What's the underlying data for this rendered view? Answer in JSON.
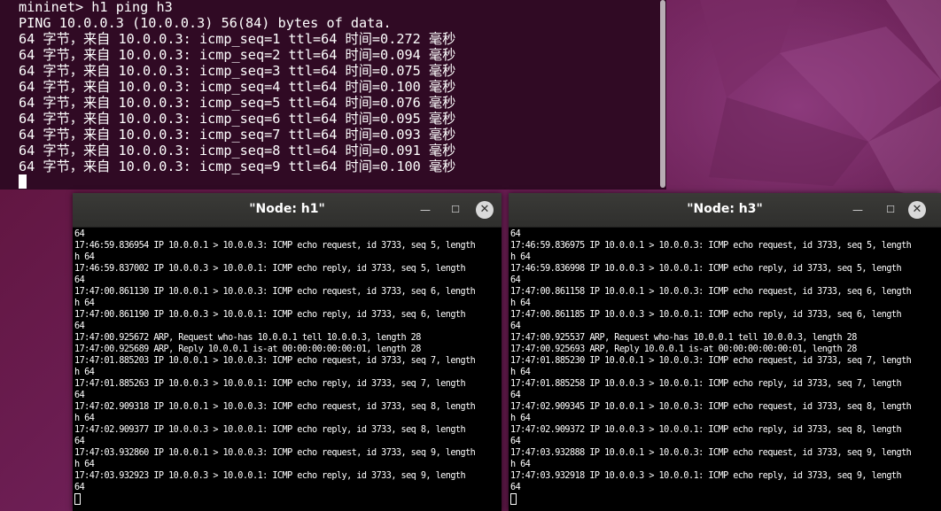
{
  "colors": {
    "terminal_bg": "#300a24",
    "terminal_fg": "#ffffff",
    "xterm_bg": "#000000",
    "titlebar_bg": "#333331",
    "desktop_accent": "#6e1f56"
  },
  "main_terminal": {
    "lines": [
      "mininet> h1 ping h3",
      "PING 10.0.0.3 (10.0.0.3) 56(84) bytes of data.",
      "64 字节，来自 10.0.0.3: icmp_seq=1 ttl=64 时间=0.272 毫秒",
      "64 字节，来自 10.0.0.3: icmp_seq=2 ttl=64 时间=0.094 毫秒",
      "64 字节，来自 10.0.0.3: icmp_seq=3 ttl=64 时间=0.075 毫秒",
      "64 字节，来自 10.0.0.3: icmp_seq=4 ttl=64 时间=0.100 毫秒",
      "64 字节，来自 10.0.0.3: icmp_seq=5 ttl=64 时间=0.076 毫秒",
      "64 字节，来自 10.0.0.3: icmp_seq=6 ttl=64 时间=0.095 毫秒",
      "64 字节，来自 10.0.0.3: icmp_seq=7 ttl=64 时间=0.093 毫秒",
      "64 字节，来自 10.0.0.3: icmp_seq=8 ttl=64 时间=0.091 毫秒",
      "64 字节，来自 10.0.0.3: icmp_seq=9 ttl=64 时间=0.100 毫秒"
    ]
  },
  "windows": {
    "h1": {
      "title": "\"Node: h1\"",
      "minimize_glyph": "—",
      "maximize_glyph": "☐",
      "close_glyph": "✕",
      "lines": [
        "64",
        "17:46:59.836954 IP 10.0.0.1 > 10.0.0.3: ICMP echo request, id 3733, seq 5, length",
        "h 64",
        "17:46:59.837002 IP 10.0.0.3 > 10.0.0.1: ICMP echo reply, id 3733, seq 5, length",
        "64",
        "17:47:00.861130 IP 10.0.0.1 > 10.0.0.3: ICMP echo request, id 3733, seq 6, length",
        "h 64",
        "17:47:00.861190 IP 10.0.0.3 > 10.0.0.1: ICMP echo reply, id 3733, seq 6, length",
        "64",
        "17:47:00.925672 ARP, Request who-has 10.0.0.1 tell 10.0.0.3, length 28",
        "17:47:00.925689 ARP, Reply 10.0.0.1 is-at 00:00:00:00:00:01, length 28",
        "17:47:01.885203 IP 10.0.0.1 > 10.0.0.3: ICMP echo request, id 3733, seq 7, length",
        "h 64",
        "17:47:01.885263 IP 10.0.0.3 > 10.0.0.1: ICMP echo reply, id 3733, seq 7, length",
        "64",
        "17:47:02.909318 IP 10.0.0.1 > 10.0.0.3: ICMP echo request, id 3733, seq 8, length",
        "h 64",
        "17:47:02.909377 IP 10.0.0.3 > 10.0.0.1: ICMP echo reply, id 3733, seq 8, length",
        "64",
        "17:47:03.932860 IP 10.0.0.1 > 10.0.0.3: ICMP echo request, id 3733, seq 9, length",
        "h 64",
        "17:47:03.932923 IP 10.0.0.3 > 10.0.0.1: ICMP echo reply, id 3733, seq 9, length",
        "64"
      ]
    },
    "h3": {
      "title": "\"Node: h3\"",
      "minimize_glyph": "—",
      "maximize_glyph": "☐",
      "close_glyph": "✕",
      "lines": [
        "64",
        "17:46:59.836975 IP 10.0.0.1 > 10.0.0.3: ICMP echo request, id 3733, seq 5, length",
        "h 64",
        "17:46:59.836998 IP 10.0.0.3 > 10.0.0.1: ICMP echo reply, id 3733, seq 5, length",
        "64",
        "17:47:00.861158 IP 10.0.0.1 > 10.0.0.3: ICMP echo request, id 3733, seq 6, length",
        "h 64",
        "17:47:00.861185 IP 10.0.0.3 > 10.0.0.1: ICMP echo reply, id 3733, seq 6, length",
        "64",
        "17:47:00.925537 ARP, Request who-has 10.0.0.1 tell 10.0.0.3, length 28",
        "17:47:00.925693 ARP, Reply 10.0.0.1 is-at 00:00:00:00:00:01, length 28",
        "17:47:01.885230 IP 10.0.0.1 > 10.0.0.3: ICMP echo request, id 3733, seq 7, length",
        "h 64",
        "17:47:01.885258 IP 10.0.0.3 > 10.0.0.1: ICMP echo reply, id 3733, seq 7, length",
        "64",
        "17:47:02.909345 IP 10.0.0.1 > 10.0.0.3: ICMP echo request, id 3733, seq 8, length",
        "h 64",
        "17:47:02.909372 IP 10.0.0.3 > 10.0.0.1: ICMP echo reply, id 3733, seq 8, length",
        "64",
        "17:47:03.932888 IP 10.0.0.1 > 10.0.0.3: ICMP echo request, id 3733, seq 9, length",
        "h 64",
        "17:47:03.932918 IP 10.0.0.3 > 10.0.0.1: ICMP echo reply, id 3733, seq 9, length",
        "64"
      ]
    }
  }
}
